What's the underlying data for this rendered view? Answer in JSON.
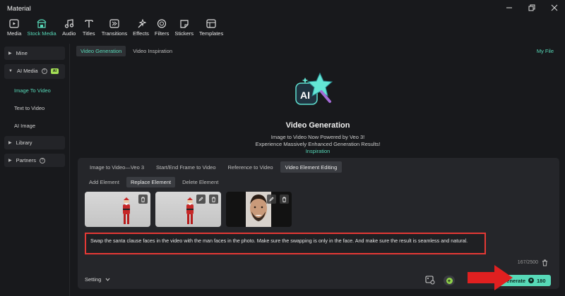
{
  "window": {
    "title": "Material"
  },
  "toolbar": {
    "items": [
      {
        "label": "Media",
        "icon": "media-icon"
      },
      {
        "label": "Stock Media",
        "icon": "stock-media-icon"
      },
      {
        "label": "Audio",
        "icon": "audio-icon"
      },
      {
        "label": "Titles",
        "icon": "titles-icon"
      },
      {
        "label": "Transitions",
        "icon": "transitions-icon"
      },
      {
        "label": "Effects",
        "icon": "effects-icon"
      },
      {
        "label": "Filters",
        "icon": "filters-icon"
      },
      {
        "label": "Stickers",
        "icon": "stickers-icon"
      },
      {
        "label": "Templates",
        "icon": "templates-icon"
      }
    ],
    "active": "Stock Media"
  },
  "sidebar": {
    "mine": "Mine",
    "ai_media": "AI Media",
    "ai_badge": "AI",
    "sub_items": [
      "Image To Video",
      "Text to Video",
      "AI Image"
    ],
    "library": "Library",
    "partners": "Partners"
  },
  "main": {
    "tabs": [
      "Video Generation",
      "Video Inspiration"
    ],
    "my_file": "My File",
    "hero_title": "Video Generation",
    "hero_line1": "Image to Video Now Powered by Veo 3!",
    "hero_line2": "Experience Massively Enhanced Generation Results!",
    "hero_link": "Inspiration"
  },
  "panel": {
    "tabs": [
      "Image to Video—Veo 3",
      "Start/End Frame to Video",
      "Reference to Video",
      "Video Element Editing"
    ],
    "active_tab": "Video Element Editing",
    "sub_tabs": [
      "Add Element",
      "Replace Element",
      "Delete Element"
    ],
    "active_sub_tab": "Replace Element",
    "prompt": "Swap the santa clause faces in the video with the man faces in the photo. Make sure the swapping is only in the face. And make sure the result is seamless and natural.",
    "counter": "167/2500",
    "setting_label": "Setting",
    "generate_label": "Generate",
    "credits": "180"
  },
  "colors": {
    "accent": "#57d9b8",
    "badge": "#a4e056",
    "highlight": "#e53935",
    "arrow": "#e02020"
  }
}
